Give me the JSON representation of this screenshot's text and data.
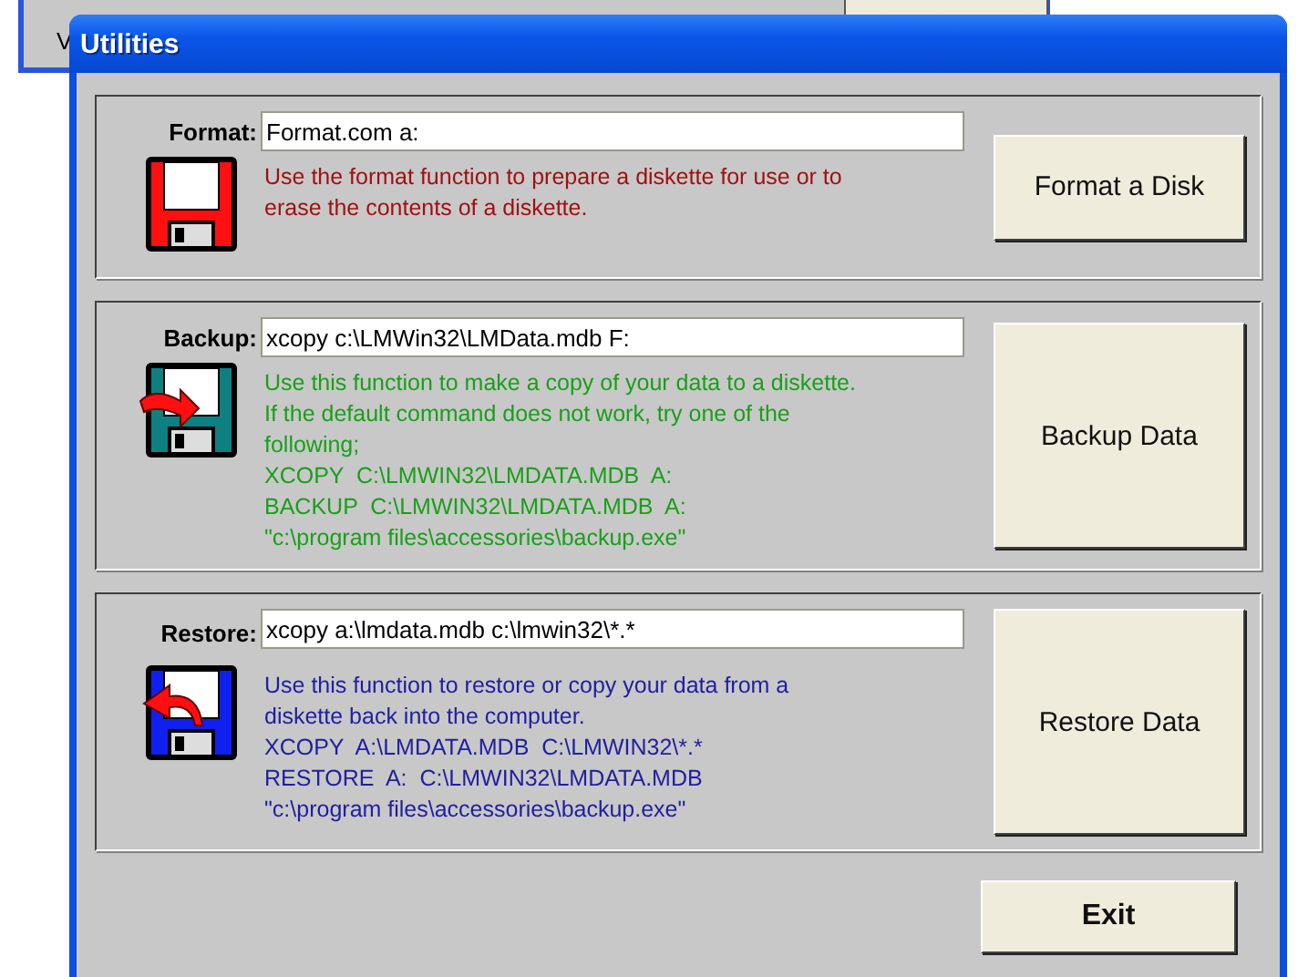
{
  "background_window": {
    "label": "V"
  },
  "window": {
    "title": "Utilities"
  },
  "sections": [
    {
      "kind": "format",
      "label": "Format:",
      "command": "Format.com a:",
      "color": "#a01010",
      "description": [
        "Use the format function to prepare a diskette for use or to",
        "erase the contents of a diskette."
      ],
      "button": "Format a Disk"
    },
    {
      "kind": "backup",
      "label": "Backup:",
      "command": "xcopy c:\\LMWin32\\LMData.mdb F:",
      "color": "#18a018",
      "description": [
        "Use this function to make a copy of your data to a diskette.",
        "If the default command does not work, try one of the",
        "following;",
        "XCOPY  C:\\LMWIN32\\LMDATA.MDB  A:",
        "BACKUP  C:\\LMWIN32\\LMDATA.MDB  A:",
        "\"c:\\program files\\accessories\\backup.exe\""
      ],
      "button": "Backup Data"
    },
    {
      "kind": "restore",
      "label": "Restore:",
      "command": "xcopy a:\\lmdata.mdb c:\\lmwin32\\*.*",
      "color": "#2020a0",
      "description": [
        "Use this function to restore or copy your data from a",
        "diskette back into the computer.",
        "XCOPY  A:\\LMDATA.MDB  C:\\LMWIN32\\*.*",
        "RESTORE  A:  C:\\LMWIN32\\LMDATA.MDB",
        "\"c:\\program files\\accessories\\backup.exe\""
      ],
      "button": "Restore Data"
    }
  ],
  "exit_button": "Exit"
}
